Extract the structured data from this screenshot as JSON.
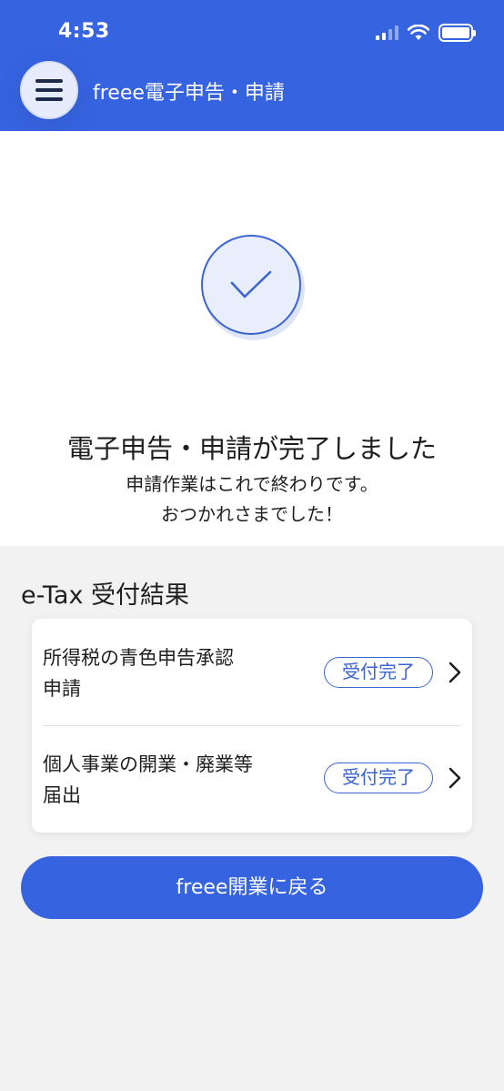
{
  "status_bar": {
    "time": "4:53"
  },
  "header": {
    "title": "freee電子申告・申請"
  },
  "hero": {
    "title": "電子申告・申請が完了しました",
    "subtitle_line1": "申請作業はこれで終わりです。",
    "subtitle_line2": "おつかれさまでした！"
  },
  "results": {
    "section_title": "e-Tax 受付結果",
    "items": [
      {
        "label_line1": "所得税の青色申告承認",
        "label_line2": "申請",
        "status": "受付完了"
      },
      {
        "label_line1": "個人事業の開業・廃業等",
        "label_line2": "届出",
        "status": "受付完了"
      }
    ]
  },
  "footer": {
    "back_button_label": "freee開業に戻る"
  },
  "colors": {
    "accent": "#3663e0",
    "status_badge": "#3c64d3",
    "background": "#f3f2f2"
  },
  "icons": [
    "menu-icon",
    "check-icon",
    "chevron-right-icon",
    "signal-icon",
    "wifi-icon",
    "battery-icon"
  ]
}
